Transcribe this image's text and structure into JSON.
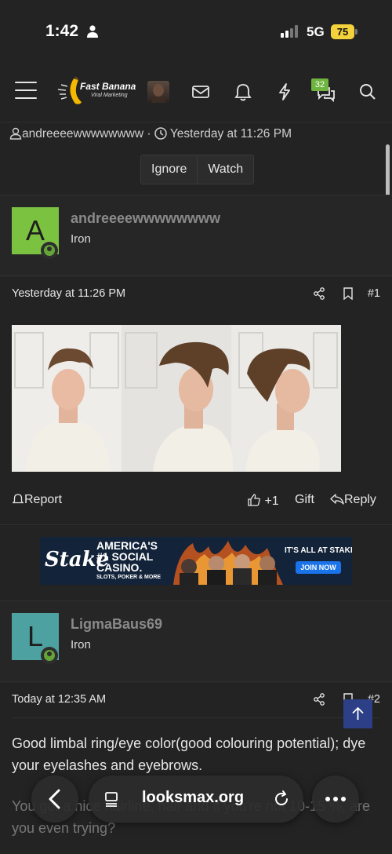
{
  "status": {
    "time": "1:42",
    "network": "5G",
    "battery": "75"
  },
  "header": {
    "logo_title": "Fast Banana",
    "logo_subtitle": "Viral Marketing",
    "conversations_badge": "32"
  },
  "thread": {
    "author": "andreeeewwwwwwww",
    "separator": "·",
    "date": "Yesterday at 11:26 PM",
    "buttons": {
      "ignore": "Ignore",
      "watch": "Watch"
    }
  },
  "posts": [
    {
      "avatar_letter": "A",
      "avatar_color": "#7cc241",
      "username": "andreeeewwwwwwww",
      "rank": "Iron",
      "date": "Yesterday at 11:26 PM",
      "number": "#1",
      "report": "Report",
      "reaction_count": "+1",
      "gift": "Gift",
      "reply": "Reply"
    },
    {
      "avatar_letter": "L",
      "avatar_color": "#4ea1a1",
      "username": "LigmaBaus69",
      "rank": "Iron",
      "date": "Today at 12:35 AM",
      "number": "#2",
      "text": "Good limbal ring/eye color(good colouring potential); dye your eyelashes and eyebrows.",
      "text_partial": "You got a nice hairline, hair and if you're not 10-15 %, are you even trying?"
    }
  ],
  "ad": {
    "brand": "Stake",
    "headline_1": "AMERICA'S",
    "headline_2": "#1 SOCIAL",
    "headline_3": "CASINO.",
    "tagline": "SLOTS, POKER & MORE",
    "right_title": "IT'S ALL AT STAKE",
    "cta": "JOIN NOW"
  },
  "browser": {
    "url": "looksmax.org"
  },
  "colors": {
    "accent": "#6eb43f",
    "scroll_top": "#2d3f86",
    "background": "#232323"
  }
}
